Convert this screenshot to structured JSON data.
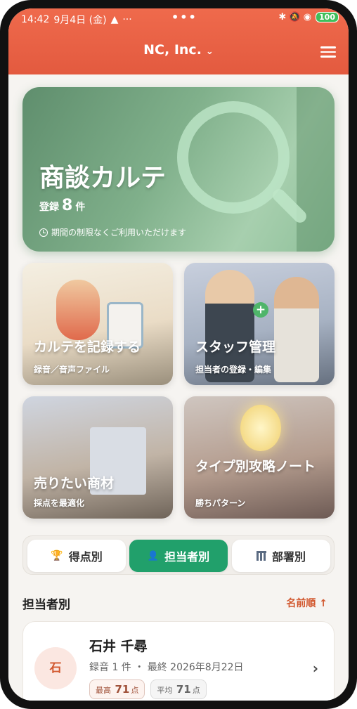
{
  "status": {
    "time": "14:42",
    "date": "9月4日 (金)",
    "alert": "▲",
    "more": "···",
    "center_dots": "•••",
    "icons": "✱ 🔕 ◉",
    "battery": "100"
  },
  "header": {
    "title": "NC, Inc.",
    "chevron": "⌄"
  },
  "hero": {
    "title": "商談カルテ",
    "count_prefix": "登録",
    "count": "8",
    "count_suffix": "件",
    "note": "期間の制限なくご利用いただけます"
  },
  "tiles": [
    {
      "title": "カルテを記録する",
      "sub": "録音／音声ファイル"
    },
    {
      "title": "スタッフ管理",
      "sub": "担当者の登録・編集"
    },
    {
      "title": "売りたい商材",
      "sub": "採点を最適化"
    },
    {
      "title": "タイプ別攻略ノート",
      "sub": "勝ちパターン"
    }
  ],
  "segment": {
    "score": "得点別",
    "staff": "担当者別",
    "dept": "部署別"
  },
  "list": {
    "title": "担当者別",
    "sort": "名前順 ↑"
  },
  "rows": [
    {
      "avatar": "石",
      "name": "石井 千尋",
      "meta": "録音 1 件 ・ 最終 2026年8月22日",
      "max_label": "最高",
      "max_val": "71",
      "avg_label": "平均",
      "avg_val": "71",
      "unit": "点"
    }
  ]
}
